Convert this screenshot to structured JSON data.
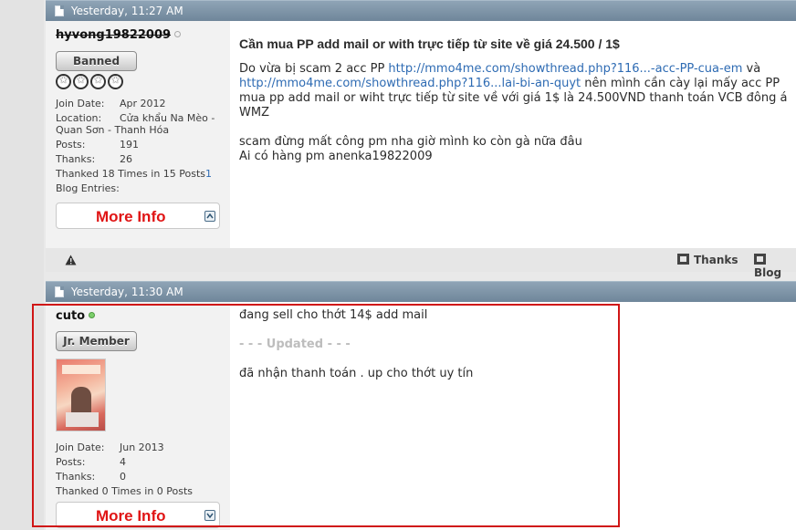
{
  "posts": [
    {
      "header": "Yesterday, 11:27 AM",
      "user": {
        "username": "hyvong19822009",
        "rank": "Banned",
        "join_date_label": "Join Date:",
        "join_date": "Apr 2012",
        "location_label": "Location:",
        "location": "Cửa khẩu Na Mèo - Quan Sơn - Thanh Hóa",
        "posts_label": "Posts:",
        "posts": "191",
        "thanks_label": "Thanks:",
        "thanks": "26",
        "thanked_prefix": "Thanked 18 Times in 15 Posts",
        "thanked_link": "1",
        "blog_label": "Blog Entries:",
        "more_info": "More Info"
      },
      "title": "Cần mua PP add mail or with trực tiếp từ site về giá 24.500 / 1$",
      "body": {
        "line1_text": "Do vừa bị scam 2 acc PP ",
        "line1_link": "http://mmo4me.com/showthread.php?116...-acc-PP-cua-em",
        "line1_end": " và",
        "line2_link": "http://mmo4me.com/showthread.php?116...lai-bi-an-quyt",
        "line2_text": " nên mình cần cày lại mấy acc PP",
        "line3": "mua pp add mail or wiht trực tiếp từ site về với giá 1$ là 24.500VND thanh toán VCB đông á",
        "line4": "WMZ",
        "line5": "scam đừng mất công pm nha giờ mình ko còn gà nữa đâu",
        "line6": "Ai có hàng pm anenka19822009"
      },
      "footer": {
        "thanks": "Thanks",
        "blog": "Blog"
      }
    },
    {
      "header": "Yesterday, 11:30 AM",
      "user": {
        "username": "cuto",
        "rank": "Jr. Member",
        "join_date_label": "Join Date:",
        "join_date": "Jun 2013",
        "posts_label": "Posts:",
        "posts": "4",
        "thanks_label": "Thanks:",
        "thanks": "0",
        "thanked": "Thanked 0 Times in 0 Posts",
        "more_info": "More Info"
      },
      "body": {
        "line1": "đang sell cho thớt 14$ add mail",
        "updated": "- - - Updated - - -",
        "line2": "đã nhận thanh toán . up cho thớt uy tín"
      }
    }
  ],
  "colors": {
    "header_bar": "#7d93a6",
    "more_info_text": "#e01414",
    "link": "#2e6bb3",
    "highlight_border": "#d01616"
  }
}
